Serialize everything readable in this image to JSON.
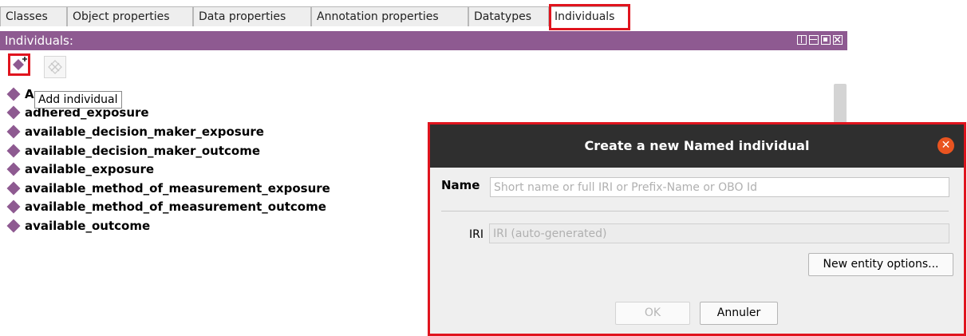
{
  "tabs": [
    {
      "label": "Classes",
      "active": false
    },
    {
      "label": "Object properties",
      "active": false
    },
    {
      "label": "Data properties",
      "active": false
    },
    {
      "label": "Annotation properties",
      "active": false
    },
    {
      "label": "Datatypes",
      "active": false
    },
    {
      "label": "Individuals",
      "active": true
    }
  ],
  "panel": {
    "title": "Individuals:",
    "header_color": "#8e5a91",
    "header_icons": [
      "split-horizontal-icon",
      "split-vertical-icon",
      "maximize-icon",
      "close-view-icon"
    ]
  },
  "toolbar": {
    "add_icon": "add-individual-icon",
    "delete_icon": "delete-individual-icon"
  },
  "tooltip": "Add individual",
  "individuals": [
    "A",
    "adhered_exposure",
    "available_decision_maker_exposure",
    "available_decision_maker_outcome",
    "available_exposure",
    "available_method_of_measurement_exposure",
    "available_method_of_measurement_outcome",
    "available_outcome"
  ],
  "dialog": {
    "title": "Create a new Named individual",
    "close_icon": "close-icon",
    "name_label": "Name",
    "name_value": "",
    "name_placeholder": "Short name or full IRI or Prefix-Name or OBO Id",
    "iri_label": "IRI",
    "iri_value": "",
    "iri_placeholder": "IRI (auto-generated)",
    "options_button": "New entity options...",
    "ok_button": "OK",
    "cancel_button": "Annuler"
  },
  "colors": {
    "highlight": "#e0141e",
    "title_bar": "#2f2f2f",
    "close_button": "#e95420"
  }
}
